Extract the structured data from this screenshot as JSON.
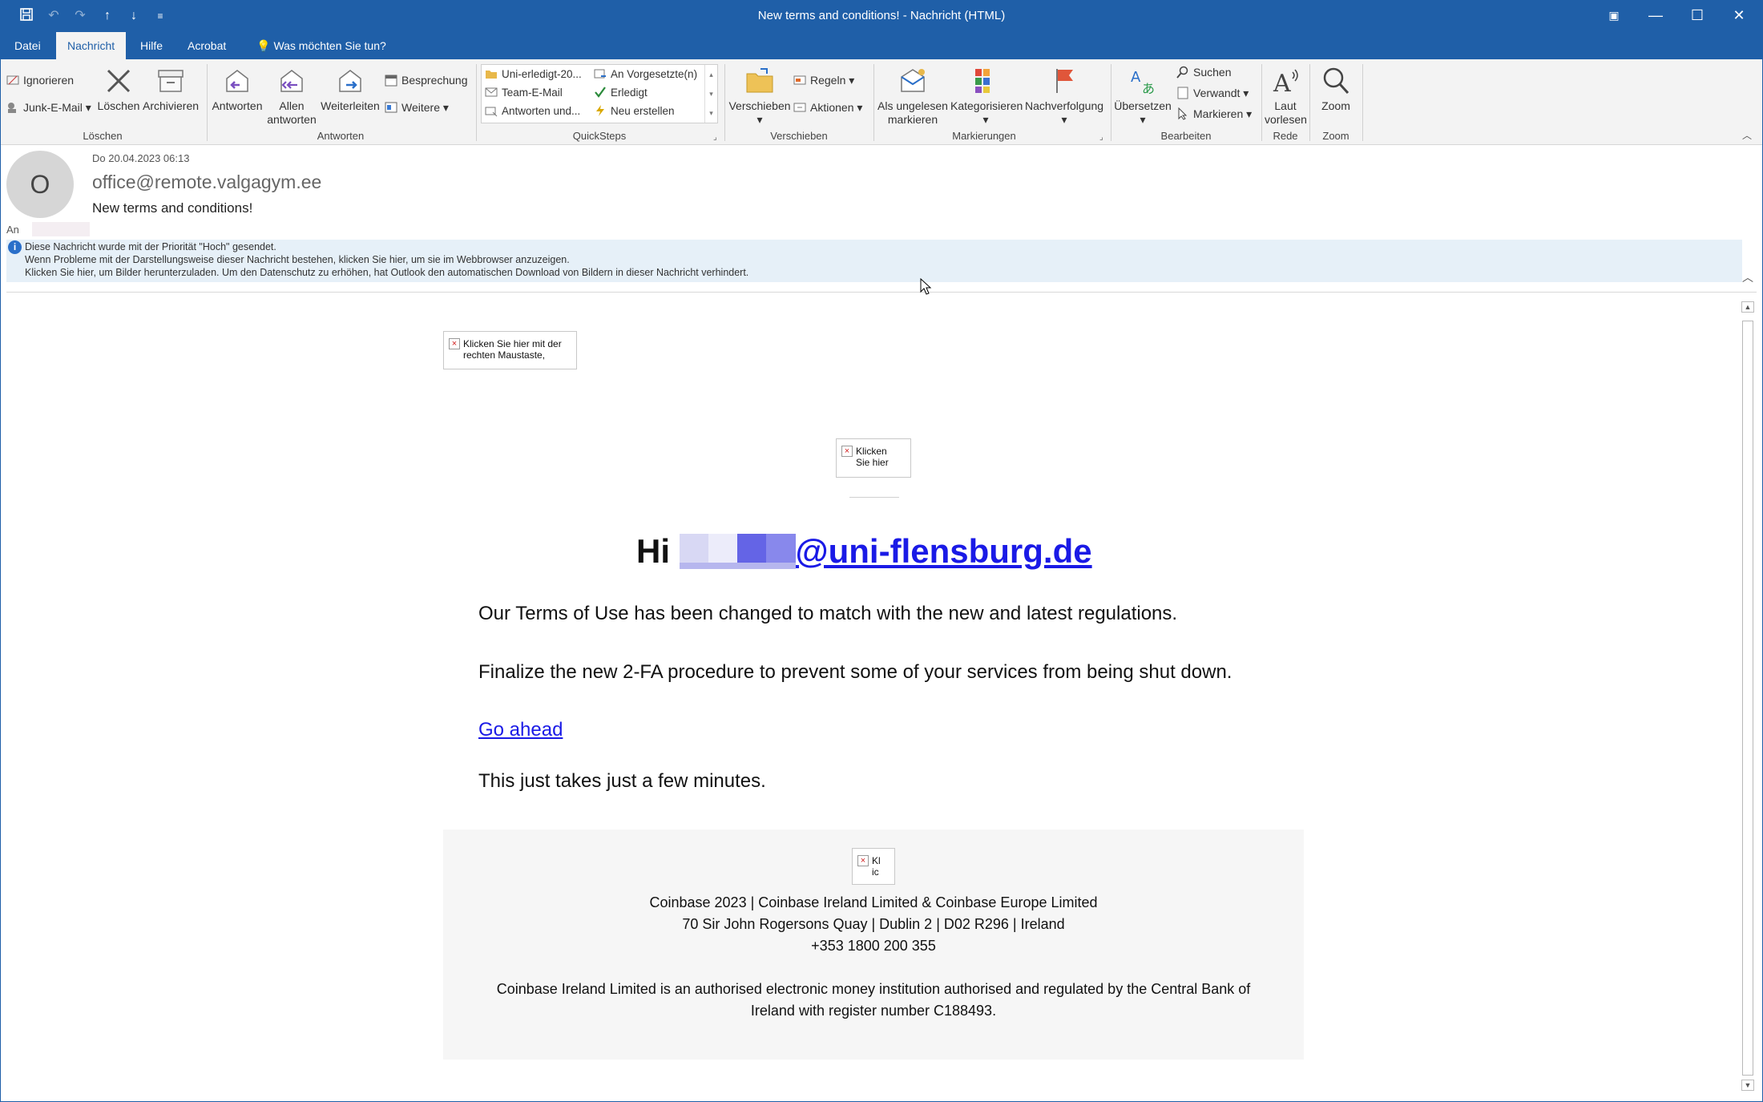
{
  "window": {
    "title": "New terms and conditions!  -  Nachricht (HTML)"
  },
  "menu": {
    "tabs": [
      "Datei",
      "Nachricht",
      "Hilfe",
      "Acrobat"
    ],
    "tell_me": "Was möchten Sie tun?"
  },
  "ribbon": {
    "delete_group": {
      "ignore": "Ignorieren",
      "junk": "Junk-E-Mail",
      "delete": "Löschen",
      "archive": "Archivieren",
      "label": "Löschen"
    },
    "respond_group": {
      "reply": "Antworten",
      "reply_all_1": "Allen",
      "reply_all_2": "antworten",
      "forward": "Weiterleiten",
      "meeting": "Besprechung",
      "more": "Weitere",
      "label": "Antworten"
    },
    "quicksteps": {
      "items": [
        "Uni-erledigt-20...",
        "Team-E-Mail",
        "Antworten und...",
        "An Vorgesetzte(n)",
        "Erledigt",
        "Neu erstellen"
      ],
      "label": "QuickSteps"
    },
    "move_group": {
      "move": "Verschieben",
      "rules": "Regeln",
      "actions": "Aktionen",
      "label": "Verschieben"
    },
    "tags_group": {
      "unread_1": "Als ungelesen",
      "unread_2": "markieren",
      "categorize": "Kategorisieren",
      "followup": "Nachverfolgung",
      "label": "Markierungen"
    },
    "edit_group": {
      "translate": "Übersetzen",
      "find": "Suchen",
      "related": "Verwandt",
      "select": "Markieren",
      "label": "Bearbeiten"
    },
    "speech_group": {
      "read_1": "Laut",
      "read_2": "vorlesen",
      "label": "Rede"
    },
    "zoom_group": {
      "zoom": "Zoom",
      "label": "Zoom"
    }
  },
  "header": {
    "avatar_letter": "O",
    "date": "Do 20.04.2023 06:13",
    "from": "office@remote.valgagym.ee",
    "subject": "New terms and conditions!",
    "to_label": "An"
  },
  "infobar": {
    "line1": "Diese Nachricht wurde mit der Priorität \"Hoch\" gesendet.",
    "line2": "Wenn Probleme mit der Darstellungsweise dieser Nachricht bestehen, klicken Sie hier, um sie im Webbrowser anzuzeigen.",
    "line3": "Klicken Sie hier, um Bilder herunterzuladen. Um den Datenschutz zu erhöhen, hat Outlook den automatischen Download von Bildern in dieser Nachricht verhindert."
  },
  "email": {
    "img1_line1": "Klicken Sie hier mit der",
    "img1_line2": "rechten Maustaste,",
    "img2_line1": "Klicken",
    "img2_line2": "Sie hier",
    "img3_line1": "Kl",
    "img3_line2": "ic",
    "greeting": "Hi",
    "greeting_email": "@uni-flensburg.de",
    "para1": "Our Terms of Use has been changed to match with the new and latest regulations.",
    "para2": "Finalize the new 2-FA procedure to prevent some of your services from being shut down.",
    "cta": "Go ahead",
    "para3": "This just takes just a few minutes.",
    "footer_line1": "Coinbase 2023 | Coinbase Ireland Limited & Coinbase Europe Limited",
    "footer_line2": "70 Sir John Rogersons Quay | Dublin 2 | D02 R296 | Ireland",
    "footer_line3": "+353 1800 200 355",
    "footer_line4": "Coinbase Ireland Limited is an authorised electronic money institution authorised and regulated by the Central Bank of",
    "footer_line5": "Ireland with register number C188493."
  },
  "colors": {
    "titlebar": "#1f5fa8",
    "ribbon": "#f3f3f3",
    "infobar": "#e6f0f8",
    "link": "#1a1ae6"
  }
}
